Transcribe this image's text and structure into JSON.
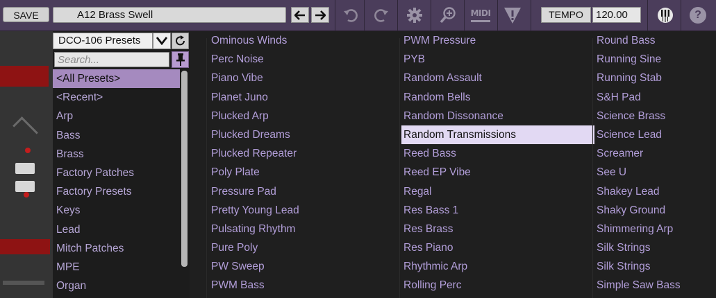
{
  "toolbar": {
    "save_label": "SAVE",
    "preset_name": "A12 Brass Swell",
    "tempo_label": "TEMPO",
    "tempo_value": "120.00",
    "midi_label": "MIDI",
    "help_label": "?"
  },
  "category_panel": {
    "bank": "DCO-106 Presets",
    "search_placeholder": "Search...",
    "items": [
      {
        "label": "<All Presets>",
        "selected": true
      },
      {
        "label": "<Recent>"
      },
      {
        "label": "Arp"
      },
      {
        "label": "Bass"
      },
      {
        "label": "Brass"
      },
      {
        "label": "Factory Patches"
      },
      {
        "label": "Factory Presets"
      },
      {
        "label": "Keys"
      },
      {
        "label": "Lead"
      },
      {
        "label": "Mitch Patches"
      },
      {
        "label": "MPE"
      },
      {
        "label": "Organ"
      }
    ]
  },
  "preset_columns": [
    [
      "Ominous Winds",
      "Perc Noise",
      "Piano Vibe",
      "Planet Juno",
      "Plucked Arp",
      "Plucked Dreams",
      "Plucked Repeater",
      "Poly Plate",
      "Pressure Pad",
      "Pretty Young Lead",
      "Pulsating Rhythm",
      "Pure Poly",
      "PW Sweep",
      "PWM Bass"
    ],
    [
      "PWM Pressure",
      "PYB",
      "Random Assault",
      "Random Bells",
      "Random Dissonance",
      "Random Transmissions",
      "Reed Bass",
      "Reed EP Vibe",
      "Regal",
      "Res Bass 1",
      "Res Brass",
      "Res Piano",
      "Rhythmic Arp",
      "Rolling Perc"
    ],
    [
      "Round Bass",
      "Running Sine",
      "Running Stab",
      "S&H Pad",
      "Science Brass",
      "Science Lead",
      "Screamer",
      "See U",
      "Shakey Lead",
      "Shaky Ground",
      "Shimmering Arp",
      "Silk Strings",
      "Silk Strings",
      "Simple Saw Bass"
    ]
  ],
  "selected_preset": "Random Transmissions",
  "colors": {
    "toolbar_bg": "#4b3d5b",
    "list_text": "#b39fda",
    "category_selected_bg": "#a58abf",
    "preset_selected_bg": "#e2d9f3"
  }
}
